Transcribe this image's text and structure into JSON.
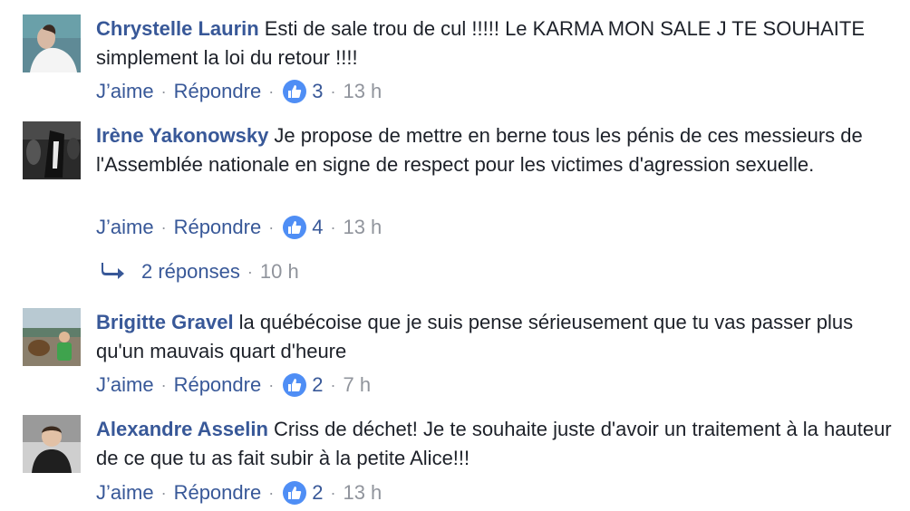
{
  "comments": [
    {
      "author": "Chrystelle Laurin",
      "text": "Esti de sale trou de cul !!!!! Le KARMA MON SALE J TE SOUHAITE simplement la loi du retour !!!!",
      "like_label": "J’aime",
      "reply_label": "Répondre",
      "likes": "3",
      "time": "13 h"
    },
    {
      "author": "Irène Yakonowsky",
      "text": "Je propose de mettre en berne tous les pénis de ces messieurs de l'Assemblée nationale en signe de respect pour les victimes d'agression sexuelle.",
      "like_label": "J’aime",
      "reply_label": "Répondre",
      "likes": "4",
      "time": "13 h",
      "replies": {
        "label": "2 réponses",
        "time": "10 h"
      }
    },
    {
      "author": "Brigitte Gravel",
      "text": "la québécoise que je suis pense sérieusement que tu vas passer plus qu'un mauvais quart d'heure",
      "like_label": "J’aime",
      "reply_label": "Répondre",
      "likes": "2",
      "time": "7 h"
    },
    {
      "author": "Alexandre Asselin",
      "text": "Criss de déchet! Je te souhaite juste d'avoir un traitement à la hauteur de ce que tu as fait subir à la petite Alice!!!",
      "like_label": "J’aime",
      "reply_label": "Répondre",
      "likes": "2",
      "time": "13 h"
    }
  ],
  "separator": "·",
  "colors": {
    "author": "#385898",
    "link": "#385898",
    "meta": "#90949c",
    "like_badge": "#4f8ef5",
    "text": "#1d2129"
  },
  "icons": {
    "like": "thumbs-up-icon",
    "reply_arrow": "reply-arrow-icon"
  }
}
